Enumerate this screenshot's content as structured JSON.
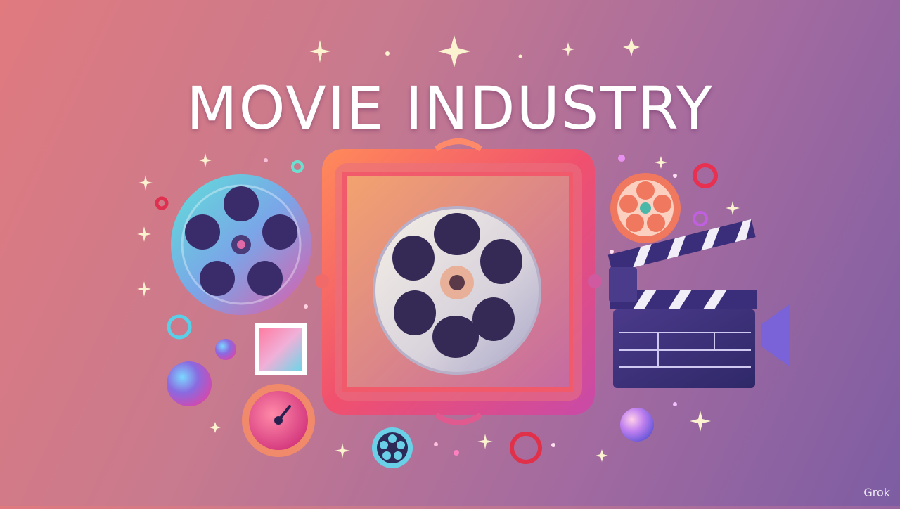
{
  "title": "MOVIE INDUSTRY",
  "watermark": "Grok"
}
